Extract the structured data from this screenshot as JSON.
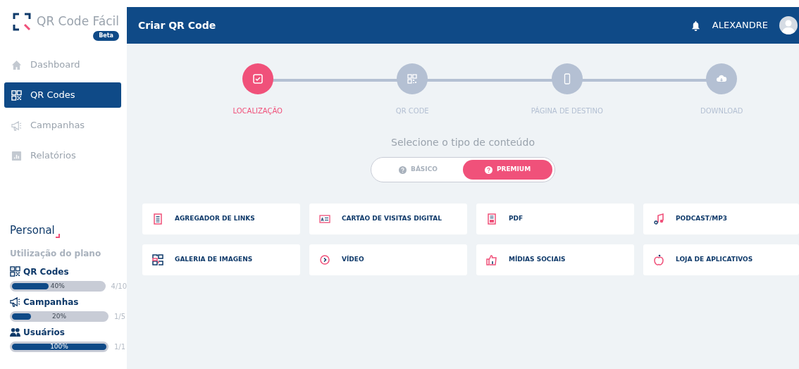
{
  "brand": {
    "name": "QR Code Fácil",
    "badge": "Beta"
  },
  "sidebar": {
    "items": [
      {
        "label": "Dashboard",
        "kind": "home",
        "selected": false
      },
      {
        "label": "QR Codes",
        "kind": "qr",
        "selected": true
      },
      {
        "label": "Campanhas",
        "kind": "megaphone",
        "selected": false
      },
      {
        "label": "Relatórios",
        "kind": "chart",
        "selected": false
      }
    ]
  },
  "plan": {
    "name": "Personal",
    "subtitle": "Utilização do plano",
    "usage": [
      {
        "label": "QR Codes",
        "kind": "qr",
        "level": 0.4,
        "percent": "40%",
        "reading": "4/10"
      },
      {
        "label": "Campanhas",
        "kind": "megaphone",
        "level": 0.2,
        "percent": "20%",
        "reading": "1/5"
      },
      {
        "label": "Usuários",
        "kind": "users",
        "level": 1,
        "percent": "100%",
        "reading": "1/1"
      }
    ]
  },
  "header": {
    "title": "Criar QR Code",
    "user": "ALEXANDRE"
  },
  "steps": [
    {
      "label": "LOCALIZAÇÃO",
      "kind": "check",
      "selected": true
    },
    {
      "label": "QR CODE",
      "kind": "qr",
      "selected": false
    },
    {
      "label": "PÁGINA DE DESTINO",
      "kind": "phone",
      "selected": false
    },
    {
      "label": "DOWNLOAD",
      "kind": "cloud",
      "selected": false
    }
  ],
  "content_prompt": "Selecione o tipo de conteúdo",
  "toggle": [
    {
      "label": "BÁSICO",
      "selected": false
    },
    {
      "label": "PREMIUM",
      "selected": true
    }
  ],
  "content_types": [
    {
      "label": "AGREGADOR DE LINKS",
      "kind": "list"
    },
    {
      "label": "CARTÃO DE VISITAS DIGITAL",
      "kind": "card"
    },
    {
      "label": "PDF",
      "kind": "pdf"
    },
    {
      "label": "PODCAST/MP3",
      "kind": "music"
    },
    {
      "label": "GALERIA DE IMAGENS",
      "kind": "gallery"
    },
    {
      "label": "VÍDEO",
      "kind": "play"
    },
    {
      "label": "MÍDIAS SOCIAIS",
      "kind": "like"
    },
    {
      "label": "LOJA DE APLICATIVOS",
      "kind": "apple"
    }
  ]
}
